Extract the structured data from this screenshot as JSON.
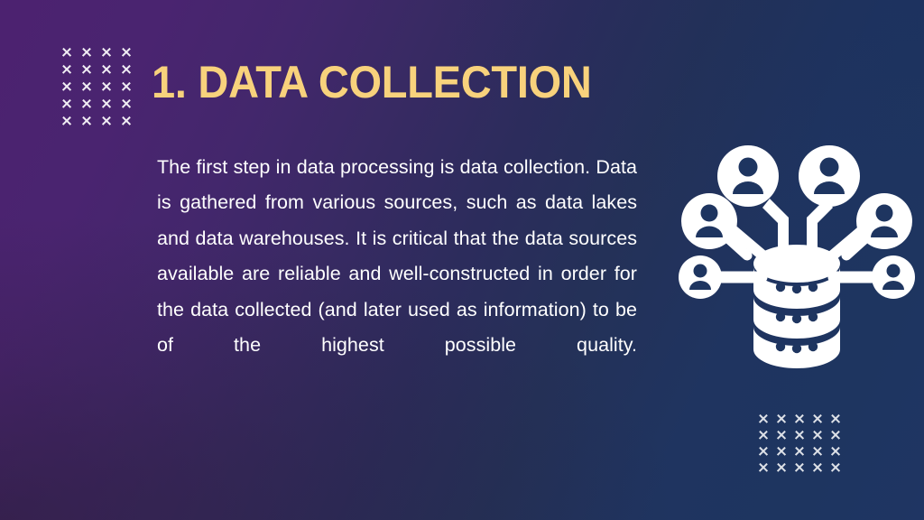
{
  "slide": {
    "background": {
      "gradient_from": "#4C2270",
      "gradient_mid": "#2C2C5C",
      "gradient_to": "#1F3564",
      "direction": "diagonal-left-purple-to-right-navy"
    },
    "title": {
      "text": "1. DATA COLLECTION",
      "color": "#F8D27C"
    },
    "body": {
      "text": "The first step in data processing is data collection. Data is gathered from various sources, such as data lakes and data warehouses. It is critical that the data sources available are reliable and well-constructed in order for the data collected (and later used as information) to be of the highest possible quality.",
      "color": "#FFFFFF",
      "alignment": "justify"
    },
    "decorations": {
      "top_left_grid": {
        "name": "x-marks-grid",
        "columns": 4,
        "rows": 5,
        "color": "#FFFFFF"
      },
      "bottom_right_grid": {
        "name": "x-marks-grid",
        "columns": 5,
        "rows": 4,
        "color": "#FFFFFF"
      }
    },
    "illustration": {
      "name": "database-network-illustration",
      "color": "#FFFFFF",
      "description": "Database cylinder connected to six user avatars",
      "database": {
        "discs": 3,
        "dots_per_disc": 3
      },
      "nodes": [
        {
          "name": "user-node-top-left",
          "type": "avatar"
        },
        {
          "name": "user-node-top-right",
          "type": "avatar"
        },
        {
          "name": "user-node-search-left",
          "type": "avatar-magnifier"
        },
        {
          "name": "user-node-search-right",
          "type": "avatar-magnifier"
        },
        {
          "name": "user-node-side-left",
          "type": "avatar-small"
        },
        {
          "name": "user-node-side-right",
          "type": "avatar-small"
        }
      ]
    }
  }
}
